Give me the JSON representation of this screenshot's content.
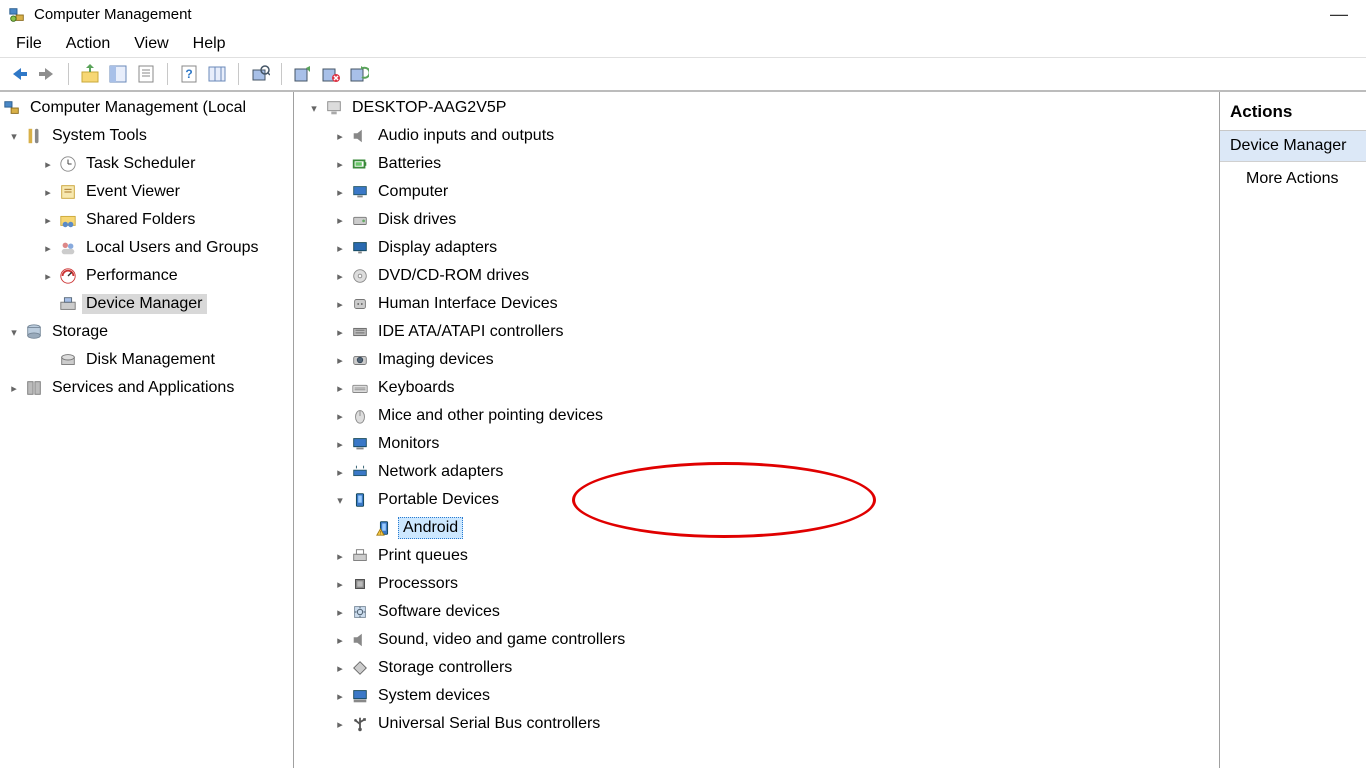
{
  "window": {
    "title": "Computer Management"
  },
  "menu": {
    "items": [
      "File",
      "Action",
      "View",
      "Help"
    ]
  },
  "left_tree": {
    "root": "Computer Management (Local",
    "system_tools": {
      "label": "System Tools",
      "children": [
        "Task Scheduler",
        "Event Viewer",
        "Shared Folders",
        "Local Users and Groups",
        "Performance",
        "Device Manager"
      ],
      "selected_index": 5
    },
    "storage": {
      "label": "Storage",
      "children": [
        "Disk Management"
      ]
    },
    "services": {
      "label": "Services and Applications"
    }
  },
  "device_tree": {
    "root": "DESKTOP-AAG2V5P",
    "categories": [
      {
        "label": "Audio inputs and outputs",
        "icon": "speaker"
      },
      {
        "label": "Batteries",
        "icon": "battery"
      },
      {
        "label": "Computer",
        "icon": "computer"
      },
      {
        "label": "Disk drives",
        "icon": "disk"
      },
      {
        "label": "Display adapters",
        "icon": "display"
      },
      {
        "label": "DVD/CD-ROM drives",
        "icon": "optical"
      },
      {
        "label": "Human Interface Devices",
        "icon": "hid"
      },
      {
        "label": "IDE ATA/ATAPI controllers",
        "icon": "ide"
      },
      {
        "label": "Imaging devices",
        "icon": "imaging"
      },
      {
        "label": "Keyboards",
        "icon": "keyboard"
      },
      {
        "label": "Mice and other pointing devices",
        "icon": "mouse"
      },
      {
        "label": "Monitors",
        "icon": "monitor"
      },
      {
        "label": "Network adapters",
        "icon": "network"
      },
      {
        "label": "Portable Devices",
        "icon": "portable",
        "expanded": true,
        "children": [
          {
            "label": "Android",
            "icon": "portable-warn",
            "selected": true
          }
        ]
      },
      {
        "label": "Print queues",
        "icon": "printer"
      },
      {
        "label": "Processors",
        "icon": "cpu"
      },
      {
        "label": "Software devices",
        "icon": "software"
      },
      {
        "label": "Sound, video and game controllers",
        "icon": "speaker"
      },
      {
        "label": "Storage controllers",
        "icon": "storage"
      },
      {
        "label": "System devices",
        "icon": "system"
      },
      {
        "label": "Universal Serial Bus controllers",
        "icon": "usb"
      }
    ]
  },
  "actions": {
    "header": "Actions",
    "selected": "Device Manager",
    "more": "More Actions"
  },
  "annotation": {
    "present": true,
    "shape": "ellipse",
    "color": "#e00000"
  }
}
